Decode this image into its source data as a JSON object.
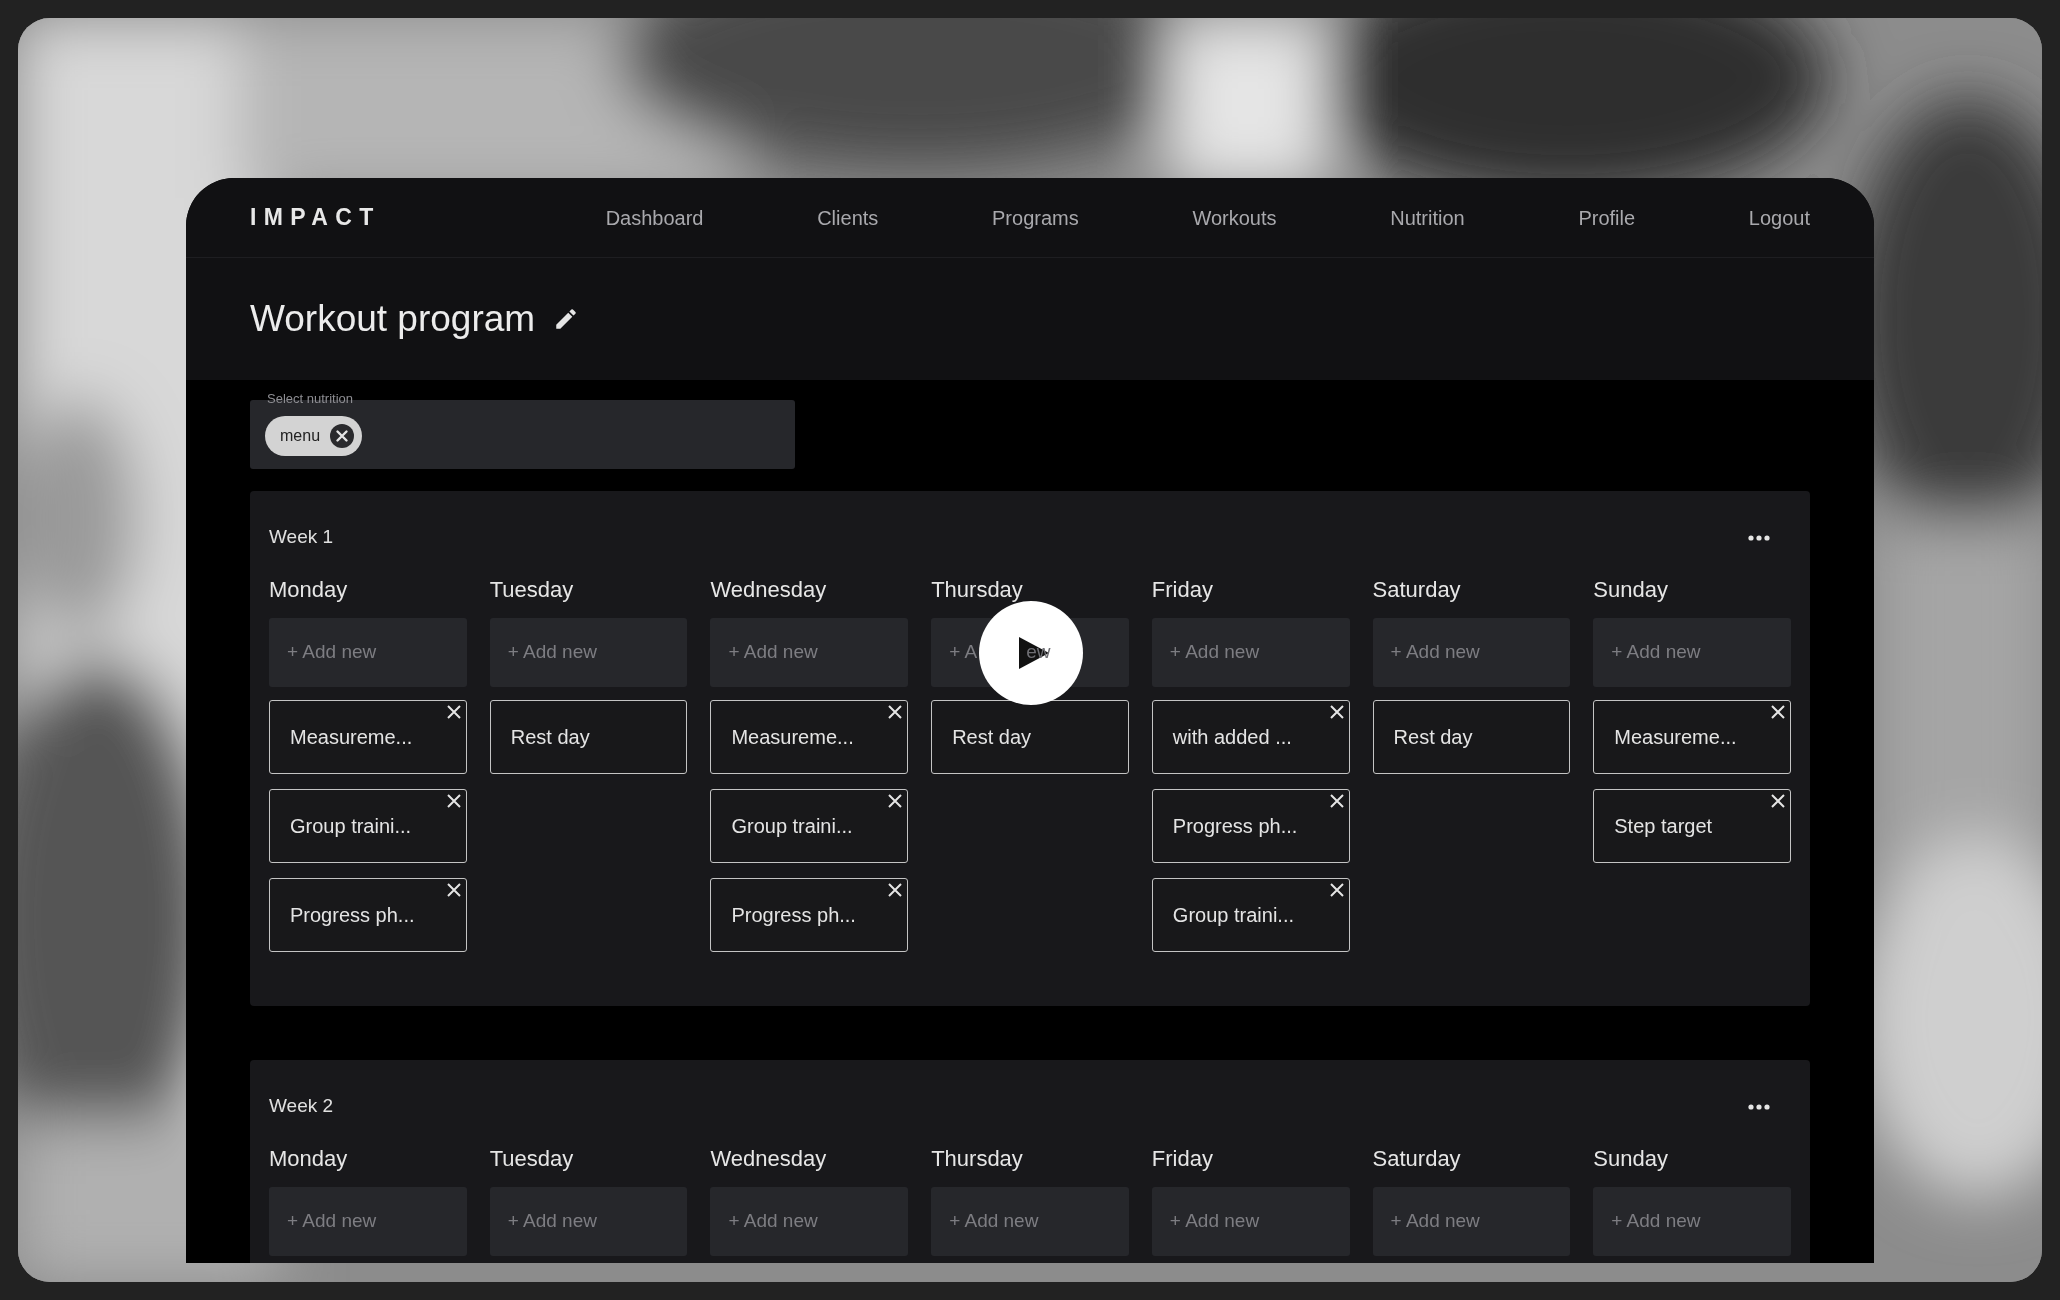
{
  "window": {
    "logo": "IMPACT",
    "nav": [
      {
        "label": "Dashboard"
      },
      {
        "label": "Clients"
      },
      {
        "label": "Programs"
      },
      {
        "label": "Workouts"
      },
      {
        "label": "Nutrition"
      },
      {
        "label": "Profile"
      },
      {
        "label": "Logout"
      }
    ]
  },
  "page_title": "Workout program",
  "nutrition_select": {
    "label": "Select nutrition",
    "chips": [
      {
        "label": "menu"
      }
    ]
  },
  "weeks": [
    {
      "title": "Week 1",
      "days": [
        {
          "name": "Monday",
          "add_label": "+ Add new",
          "items": [
            {
              "text": "Measureme...",
              "removable": true
            },
            {
              "text": "Group traini...",
              "removable": true
            },
            {
              "text": "Progress ph...",
              "removable": true
            }
          ]
        },
        {
          "name": "Tuesday",
          "add_label": "+ Add new",
          "items": [
            {
              "text": "Rest day",
              "removable": false
            }
          ]
        },
        {
          "name": "Wednesday",
          "add_label": "+ Add new",
          "items": [
            {
              "text": "Measureme...",
              "removable": true
            },
            {
              "text": "Group traini...",
              "removable": true
            },
            {
              "text": "Progress ph...",
              "removable": true
            }
          ]
        },
        {
          "name": "Thursday",
          "add_label": "+ A",
          "add_label_end": "ew",
          "items": [
            {
              "text": "Rest day",
              "removable": false
            }
          ]
        },
        {
          "name": "Friday",
          "add_label": "+ Add new",
          "items": [
            {
              "text": "with added ...",
              "removable": true
            },
            {
              "text": "Progress ph...",
              "removable": true
            },
            {
              "text": "Group traini...",
              "removable": true
            }
          ]
        },
        {
          "name": "Saturday",
          "add_label": "+ Add new",
          "items": [
            {
              "text": "Rest day",
              "removable": false
            }
          ]
        },
        {
          "name": "Sunday",
          "add_label": "+ Add new",
          "items": [
            {
              "text": "Measureme...",
              "removable": true
            },
            {
              "text": "Step target",
              "removable": true
            }
          ]
        }
      ]
    },
    {
      "title": "Week 2",
      "days": [
        {
          "name": "Monday",
          "add_label": "+ Add new"
        },
        {
          "name": "Tuesday",
          "add_label": "+ Add new"
        },
        {
          "name": "Wednesday",
          "add_label": "+ Add new"
        },
        {
          "name": "Thursday",
          "add_label": "+ Add new"
        },
        {
          "name": "Friday",
          "add_label": "+ Add new"
        },
        {
          "name": "Saturday",
          "add_label": "+ Add new"
        },
        {
          "name": "Sunday",
          "add_label": "+ Add new"
        }
      ]
    }
  ]
}
